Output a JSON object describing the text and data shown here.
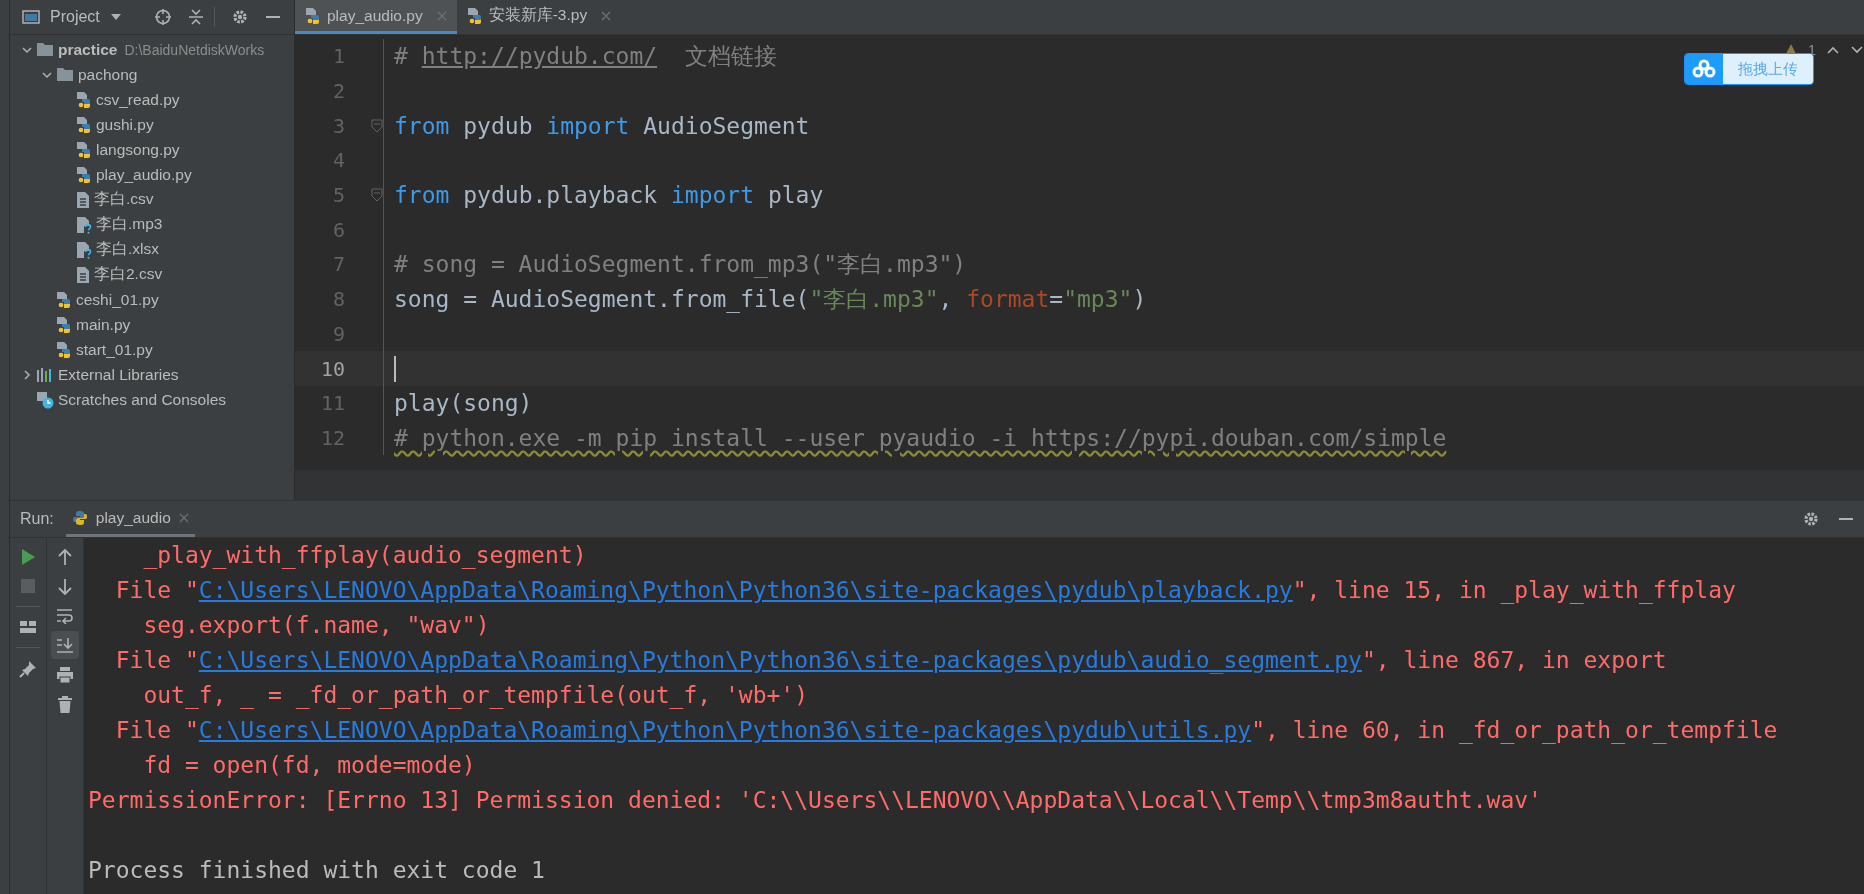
{
  "project": {
    "title": "Project",
    "tree": [
      {
        "name": "practice",
        "kind": "folder",
        "hint": "D:\\BaiduNetdiskWorks",
        "expanded": true,
        "children": [
          {
            "name": "pachong",
            "kind": "folder",
            "expanded": true,
            "children": [
              {
                "name": "csv_read.py",
                "kind": "python"
              },
              {
                "name": "gushi.py",
                "kind": "python"
              },
              {
                "name": "langsong.py",
                "kind": "python"
              },
              {
                "name": "play_audio.py",
                "kind": "python"
              },
              {
                "name": "李白.csv",
                "kind": "text"
              },
              {
                "name": "李白.mp3",
                "kind": "unknown"
              },
              {
                "name": "李白.xlsx",
                "kind": "unknown"
              },
              {
                "name": "李白2.csv",
                "kind": "text"
              }
            ]
          },
          {
            "name": "ceshi_01.py",
            "kind": "python"
          },
          {
            "name": "main.py",
            "kind": "python"
          },
          {
            "name": "start_01.py",
            "kind": "python"
          }
        ]
      },
      {
        "name": "External Libraries",
        "kind": "libraries",
        "expanded": false
      },
      {
        "name": "Scratches and Consoles",
        "kind": "scratches"
      }
    ]
  },
  "editor": {
    "tabs": [
      {
        "label": "play_audio.py",
        "selected": true
      },
      {
        "label": "安装新库-3.py",
        "selected": false
      }
    ],
    "warnings": "1",
    "lines": [
      {
        "number": "1",
        "current": false,
        "fold": false,
        "tokens": [
          {
            "t": "# ",
            "kind": "comment"
          },
          {
            "t": "http://pydub.com/",
            "kind": "link"
          },
          {
            "t": "  文档链接",
            "kind": "comment"
          }
        ]
      },
      {
        "number": "2",
        "current": false,
        "fold": false
      },
      {
        "number": "3",
        "current": false,
        "fold": true,
        "tokens": [
          {
            "t": "from",
            "kind": "keyword"
          },
          {
            "t": " pydub ",
            "kind": "plain"
          },
          {
            "t": "import",
            "kind": "keyword"
          },
          {
            "t": " AudioSegment",
            "kind": "plain"
          }
        ]
      },
      {
        "number": "4",
        "current": false,
        "fold": false
      },
      {
        "number": "5",
        "current": false,
        "fold": true,
        "tokens": [
          {
            "t": "from",
            "kind": "keyword"
          },
          {
            "t": " pydub.playback ",
            "kind": "plain"
          },
          {
            "t": "import",
            "kind": "keyword"
          },
          {
            "t": " play",
            "kind": "plain"
          }
        ]
      },
      {
        "number": "6",
        "current": false,
        "fold": false
      },
      {
        "number": "7",
        "current": false,
        "fold": false,
        "tokens": [
          {
            "t": "# song = AudioSegment.from_mp3(\"李白.mp3\")",
            "kind": "comment"
          }
        ]
      },
      {
        "number": "8",
        "current": false,
        "fold": false,
        "tokens": [
          {
            "t": "song = AudioSegment.from_file(",
            "kind": "plain"
          },
          {
            "t": "\"李白.mp3\"",
            "kind": "string"
          },
          {
            "t": ", ",
            "kind": "plain"
          },
          {
            "t": "format",
            "kind": "param"
          },
          {
            "t": "=",
            "kind": "plain"
          },
          {
            "t": "\"mp3\"",
            "kind": "string"
          },
          {
            "t": ")",
            "kind": "plain"
          }
        ]
      },
      {
        "number": "9",
        "current": false,
        "fold": false
      },
      {
        "number": "10",
        "current": true,
        "fold": false
      },
      {
        "number": "11",
        "current": false,
        "fold": false,
        "tokens": [
          {
            "t": "play(song)",
            "kind": "plain"
          }
        ]
      },
      {
        "number": "12",
        "current": false,
        "fold": false,
        "tokens": [
          {
            "t": "# python.exe -m pip install --user pyaudio -i https://pypi.douban.com/simple",
            "kind": "weak"
          }
        ]
      }
    ]
  },
  "upload_widget": {
    "label": "拖拽上传"
  },
  "run": {
    "label": "Run:",
    "tab": "play_audio",
    "lines": [
      {
        "kind": "error",
        "tokens": [
          {
            "t": "    _play_with_ffplay(audio_segment)",
            "kind": "text"
          }
        ]
      },
      {
        "kind": "error",
        "tokens": [
          {
            "t": "  File \"",
            "kind": "text"
          },
          {
            "t": "C:\\Users\\LENOVO\\AppData\\Roaming\\Python\\Python36\\site-packages\\pydub\\playback.py",
            "kind": "link"
          },
          {
            "t": "\", line 15, in _play_with_ffplay",
            "kind": "text"
          }
        ]
      },
      {
        "kind": "error",
        "tokens": [
          {
            "t": "    seg.export(f.name, \"wav\")",
            "kind": "text"
          }
        ]
      },
      {
        "kind": "error",
        "tokens": [
          {
            "t": "  File \"",
            "kind": "text"
          },
          {
            "t": "C:\\Users\\LENOVO\\AppData\\Roaming\\Python\\Python36\\site-packages\\pydub\\audio_segment.py",
            "kind": "link"
          },
          {
            "t": "\", line 867, in export",
            "kind": "text"
          }
        ]
      },
      {
        "kind": "error",
        "tokens": [
          {
            "t": "    out_f, _ = _fd_or_path_or_tempfile(out_f, 'wb+')",
            "kind": "text"
          }
        ]
      },
      {
        "kind": "error",
        "tokens": [
          {
            "t": "  File \"",
            "kind": "text"
          },
          {
            "t": "C:\\Users\\LENOVO\\AppData\\Roaming\\Python\\Python36\\site-packages\\pydub\\utils.py",
            "kind": "link"
          },
          {
            "t": "\", line 60, in _fd_or_path_or_tempfile",
            "kind": "text"
          }
        ]
      },
      {
        "kind": "error",
        "tokens": [
          {
            "t": "    fd = open(fd, mode=mode)",
            "kind": "text"
          }
        ]
      },
      {
        "kind": "error",
        "tokens": [
          {
            "t": "PermissionError: [Errno 13] Permission denied: 'C:\\\\Users\\\\LENOVO\\\\AppData\\\\Local\\\\Temp\\\\tmp3m8autht.wav'",
            "kind": "text"
          }
        ]
      },
      {
        "kind": "exit",
        "tokens": [
          {
            "t": "Process finished with exit code 1",
            "kind": "text"
          }
        ]
      }
    ]
  }
}
